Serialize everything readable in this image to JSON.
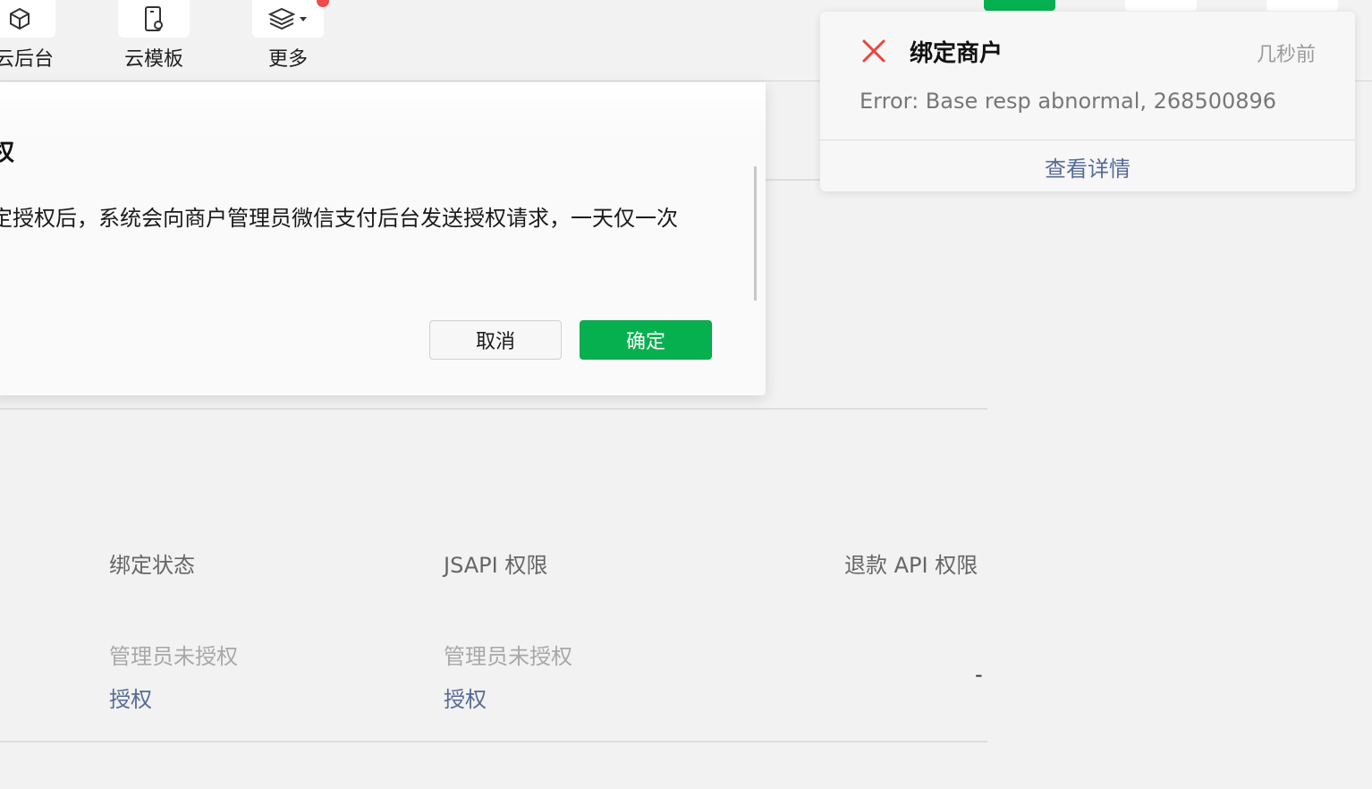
{
  "toolbar": {
    "items": [
      {
        "label": "云后台",
        "icon": "cube-icon"
      },
      {
        "label": "云模板",
        "icon": "phone-template-icon"
      },
      {
        "label": "更多",
        "icon": "layers-icon"
      }
    ],
    "more_badge_color": "#f04b4b"
  },
  "table": {
    "headers": [
      "绑定状态",
      "JSAPI 权限",
      "退款 API 权限"
    ],
    "status_texts": [
      "管理员未授权",
      "管理员未授权"
    ],
    "action_links": [
      "授权",
      "授权"
    ],
    "refund_value": "-"
  },
  "dialog": {
    "title": "权",
    "body": "定授权后，系统会向商户管理员微信支付后台发送授权请求，一天仅一次",
    "cancel_label": "取消",
    "confirm_label": "确定",
    "confirm_color": "#07b04f"
  },
  "notification": {
    "icon": "close-icon",
    "title": "绑定商户",
    "time": "几秒前",
    "message": "Error: Base resp abnormal, 268500896",
    "link_label": "查看详情",
    "icon_color": "#e8453c"
  }
}
